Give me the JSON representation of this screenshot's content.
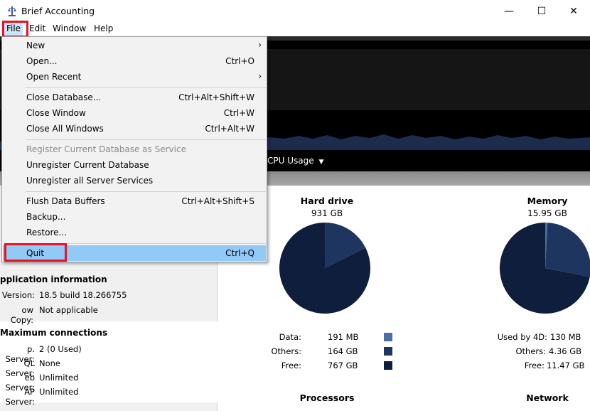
{
  "window": {
    "title": "Brief Accounting",
    "minimize_glyph": "—",
    "maximize_glyph": "☐",
    "close_glyph": "✕",
    "app_icon": "scales-icon"
  },
  "menubar": {
    "items": [
      {
        "label": "File"
      },
      {
        "label": "Edit"
      },
      {
        "label": "Window"
      },
      {
        "label": "Help"
      }
    ]
  },
  "file_menu": {
    "items": [
      {
        "label": "New",
        "shortcut": "",
        "submenu": true
      },
      {
        "label": "Open...",
        "shortcut": "Ctrl+O"
      },
      {
        "label": "Open Recent",
        "shortcut": "",
        "submenu": true
      },
      {
        "label": "Close Database...",
        "shortcut": "Ctrl+Alt+Shift+W"
      },
      {
        "label": "Close Window",
        "shortcut": "Ctrl+W"
      },
      {
        "label": "Close All Windows",
        "shortcut": "Ctrl+Alt+W"
      },
      {
        "label": "Register Current Database as Service",
        "shortcut": "",
        "disabled": true
      },
      {
        "label": "Unregister Current Database",
        "shortcut": ""
      },
      {
        "label": "Unregister all Server Services",
        "shortcut": ""
      },
      {
        "label": "Flush Data Buffers",
        "shortcut": "Ctrl+Alt+Shift+S"
      },
      {
        "label": "Backup...",
        "shortcut": ""
      },
      {
        "label": "Restore...",
        "shortcut": ""
      },
      {
        "label": "Quit",
        "shortcut": "Ctrl+Q",
        "highlighted": true
      }
    ],
    "submenu_arrow": "›"
  },
  "monitor": {
    "graph_selector": "CPU Usage",
    "dropdown_glyph": "▼"
  },
  "left_panel": {
    "app_info_title": "pplication information",
    "version_key": "Version:",
    "version_val": "18.5 build 18.266755",
    "copy_key": "ow Copy:",
    "copy_val": "Not applicable",
    "max_conn_title": "Maximum connections",
    "rows": [
      {
        "key": "p. Server:",
        "val": "2 (0 Used)"
      },
      {
        "key": "QL Server:",
        "val": "None"
      },
      {
        "key": "eb Server:",
        "val": "Unlimited"
      },
      {
        "key": "AP Server:",
        "val": "Unlimited"
      }
    ]
  },
  "hard_drive": {
    "title": "Hard drive",
    "total": "931 GB",
    "legend": [
      {
        "key": "Data:",
        "val": "191 MB",
        "color": "#4a6fa5"
      },
      {
        "key": "Others:",
        "val": "164 GB",
        "color": "#1e3560"
      },
      {
        "key": "Free:",
        "val": "767 GB",
        "color": "#0f1e3d"
      }
    ],
    "slices": [
      0.0002,
      0.176,
      0.8238
    ]
  },
  "memory": {
    "title": "Memory",
    "total": "15.95 GB",
    "legend": [
      {
        "key": "Used by 4D:",
        "val": "130 MB"
      },
      {
        "key": "Others:",
        "val": "4.36 GB"
      },
      {
        "key": "Free:",
        "val": "11.47 GB"
      }
    ],
    "slices": [
      0.008,
      0.273,
      0.719
    ]
  },
  "bottom_titles": {
    "processors": "Processors",
    "network": "Network"
  },
  "colors": {
    "menu_highlight": "#91c9f7",
    "annotation_red": "#e81123",
    "pie_dark": "#0f1e3d",
    "pie_mid": "#1e3560",
    "pie_light": "#4a6fa5"
  }
}
